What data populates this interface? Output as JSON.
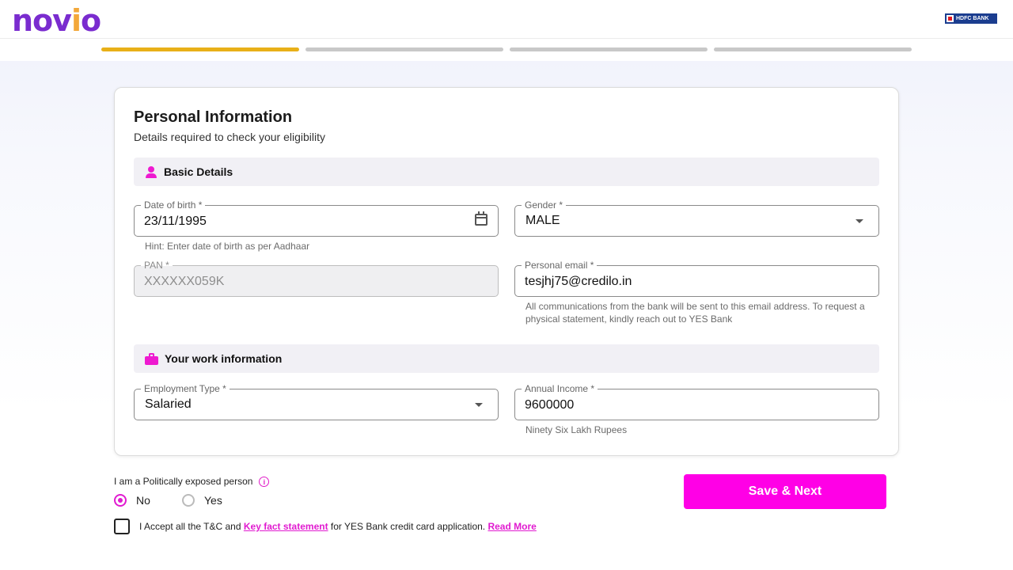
{
  "header": {
    "logo_text_pre": "nov",
    "logo_text_dot": "i",
    "logo_text_post": "o",
    "bank_logo": "HDFC BANK",
    "steps": [
      {
        "state": "active"
      },
      {
        "state": "inactive"
      },
      {
        "state": "inactive"
      },
      {
        "state": "inactive"
      }
    ]
  },
  "form": {
    "title": "Personal Information",
    "subtitle": "Details required to check your eligibility",
    "basic_section": {
      "label": "Basic Details",
      "icon": "person-icon"
    },
    "dob": {
      "label": "Date of birth *",
      "value": "23/11/1995",
      "hint": "Hint: Enter date of birth as per Aadhaar",
      "icon": "calendar-icon"
    },
    "gender": {
      "label": "Gender *",
      "value": "MALE"
    },
    "pan": {
      "label": "PAN *",
      "value": "XXXXXX059K",
      "disabled": true
    },
    "email": {
      "label": "Personal email *",
      "value": "tesjhj75@credilo.in",
      "hint_line1": "All communications from the bank will be sent to this email address. To request a",
      "hint_line2": "physical statement, kindly reach out to YES Bank"
    },
    "work_section": {
      "label": "Your work information",
      "icon": "briefcase-icon"
    },
    "employment": {
      "label": "Employment Type *",
      "value": "Salaried"
    },
    "income": {
      "label": "Annual Income *",
      "value": "9600000",
      "hint": "Ninety Six Lakh Rupees"
    }
  },
  "pep": {
    "question": "I am a Politically exposed person",
    "icon": "info-icon",
    "options": [
      {
        "label": "No",
        "checked": true
      },
      {
        "label": "Yes",
        "checked": false
      }
    ]
  },
  "terms": {
    "text_before": "I Accept all the T&C and ",
    "link_kfs": "Key fact statement",
    "text_middle": " for YES Bank credit card application. ",
    "link_read_more": "Read More",
    "checked": false
  },
  "actions": {
    "save_label": "Save & Next"
  },
  "colors": {
    "brand_purple": "#7a2ccf",
    "accent_pink": "#ff00e6",
    "step_active": "#e8b018",
    "step_inactive": "#c8c8c8"
  }
}
